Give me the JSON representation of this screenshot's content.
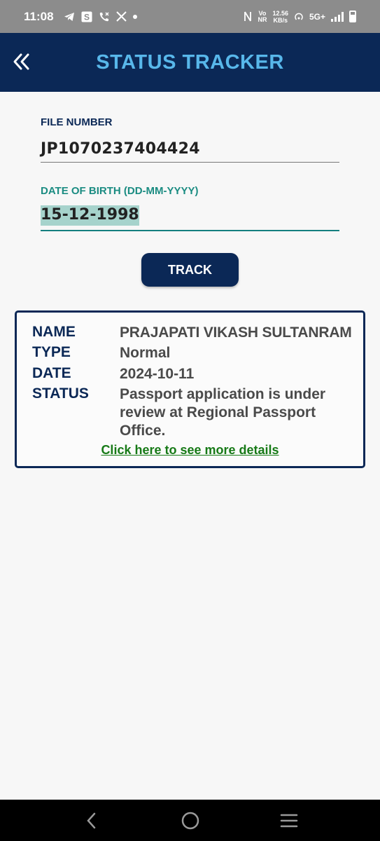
{
  "status_bar": {
    "time": "11:08",
    "vo_top": "Vo",
    "vo_bottom": "NR",
    "speed_top": "12.56",
    "speed_bottom": "KB/s",
    "network": "5G+"
  },
  "header": {
    "title": "STATUS TRACKER",
    "back_icon": "double-chevron-left-icon"
  },
  "form": {
    "file_number_label": "FILE NUMBER",
    "file_number_value": "JP1070237404424",
    "dob_label": "DATE OF BIRTH (DD-MM-YYYY)",
    "dob_value": "15-12-1998",
    "track_label": "TRACK"
  },
  "result": {
    "name_key": "NAME",
    "name_value": "PRAJAPATI VIKASH SULTANRAM",
    "type_key": "TYPE",
    "type_value": "Normal",
    "date_key": "DATE",
    "date_value": "2024-10-11",
    "status_key": "STATUS",
    "status_value": "Passport application is under review at Regional Passport Office.",
    "details_link": "Click here to see more details"
  },
  "colors": {
    "primary": "#0b2856",
    "title": "#58b7ea",
    "accent": "#1b8c82",
    "link": "#177a17"
  }
}
